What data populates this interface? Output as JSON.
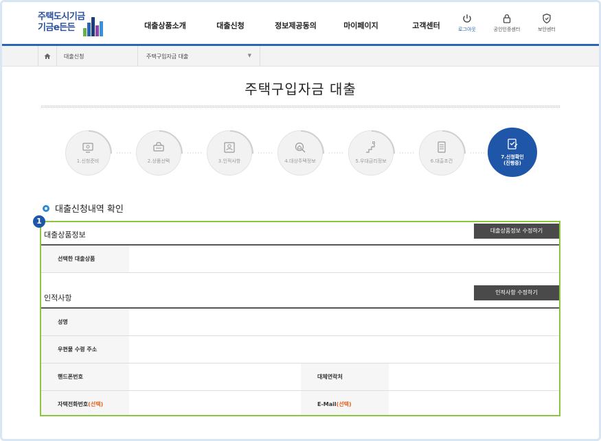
{
  "header": {
    "logo_line1": "주택도시기금",
    "logo_line2": "기금e든든",
    "nav": [
      "대출상품소개",
      "대출신청",
      "정보제공동의",
      "마이페이지",
      "고객센터"
    ],
    "util": [
      {
        "label": "로그아웃",
        "icon": "power-icon"
      },
      {
        "label": "공인인증센터",
        "icon": "lock-icon"
      },
      {
        "label": "보안센터",
        "icon": "shield-icon"
      }
    ]
  },
  "breadcrumb": {
    "level1": "대출신청",
    "level2": "주택구입자금 대출"
  },
  "page_title": "주택구입자금 대출",
  "steps": [
    {
      "label": "1.신청준비"
    },
    {
      "label": "2.상품선택"
    },
    {
      "label": "3.인적사항"
    },
    {
      "label": "4.대상주택정보"
    },
    {
      "label": "5.우대금리정보"
    },
    {
      "label": "6.대출조건"
    },
    {
      "label": "7.신청확인",
      "sub": "(진행중)"
    }
  ],
  "section_title": "대출신청내역 확인",
  "marker": "1",
  "groups": {
    "loan": {
      "title": "대출상품정보",
      "button": "대출상품정보 수정하기",
      "field_selected_product": "선택한 대출상품"
    },
    "personal": {
      "title": "인적사항",
      "button": "인적사항 수정하기",
      "field_name": "성명",
      "field_address": "우편물 수령 주소",
      "field_mobile": "핸드폰번호",
      "field_alt_contact": "대체연락처",
      "field_home_phone": "자택전화번호",
      "field_email": "E-Mail",
      "optional_tag": "(선택)"
    }
  },
  "colors": {
    "primary": "#1f56a8",
    "accent_green": "#8cc63f",
    "optional_orange": "#e0621b"
  }
}
